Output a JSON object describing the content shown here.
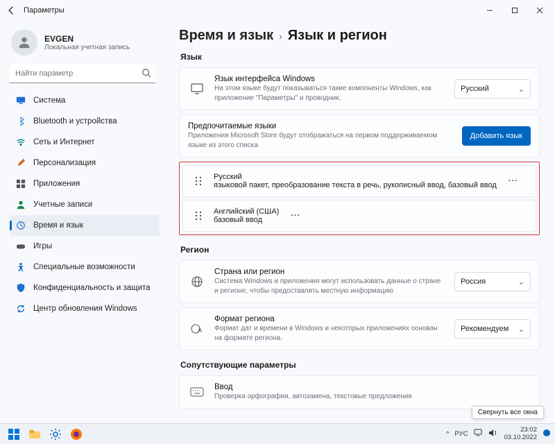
{
  "titlebar": {
    "app_title": "Параметры"
  },
  "account": {
    "name": "EVGEN",
    "sub": "Локальная учетная запись"
  },
  "search": {
    "placeholder": "Найти параметр"
  },
  "sidebar": {
    "items": [
      {
        "label": "Система"
      },
      {
        "label": "Bluetooth и устройства"
      },
      {
        "label": "Сеть и Интернет"
      },
      {
        "label": "Персонализация"
      },
      {
        "label": "Приложения"
      },
      {
        "label": "Учетные записи"
      },
      {
        "label": "Время и язык"
      },
      {
        "label": "Игры"
      },
      {
        "label": "Специальные возможности"
      },
      {
        "label": "Конфиденциальность и защита"
      },
      {
        "label": "Центр обновления Windows"
      }
    ]
  },
  "breadcrumb": {
    "parent": "Время и язык",
    "leaf": "Язык и регион"
  },
  "sections": {
    "language_title": "Язык",
    "display_lang": {
      "title": "Язык интерфейса Windows",
      "desc": "На этом языке будут показываться такие компоненты Windows, как приложение \"Параметры\" и проводник.",
      "value": "Русский"
    },
    "preferred": {
      "title": "Предпочитаемые языки",
      "desc": "Приложения Microsoft Store будут отображаться на первом поддерживаемом языке из этого списка",
      "add_btn": "Добавить язык"
    },
    "langs": [
      {
        "name": "Русский",
        "desc": "языковой пакет, преобразование текста в речь, рукописный ввод, базовый ввод"
      },
      {
        "name": "Английский (США)",
        "desc": "базовый ввод"
      }
    ],
    "region_title": "Регион",
    "country": {
      "title": "Страна или регион",
      "desc": "Система Windows и приложения могут использовать данные о стране и регионе, чтобы предоставлять местную информацию",
      "value": "Россия"
    },
    "regional_format": {
      "title": "Формат региона",
      "desc": "Формат дат и времени в Windows и некоторых приложениях основан на формате региона.",
      "value": "Рекомендуем"
    },
    "related_title": "Сопутствующие параметры",
    "input": {
      "title": "Ввод",
      "desc": "Проверка орфографии, автозамена, текстовые предложения"
    }
  },
  "tooltip": "Свернуть все окна",
  "tray": {
    "up": "^",
    "lang": "РУС",
    "time": "23:02",
    "date": "03.10.2022"
  }
}
